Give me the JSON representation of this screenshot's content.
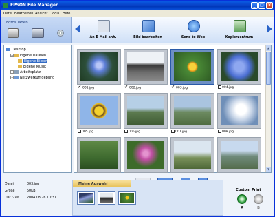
{
  "window": {
    "title": "EPSON File Manager"
  },
  "menu": [
    "Datei",
    "Bearbeiten",
    "Ansicht",
    "Tools",
    "Hilfe"
  ],
  "import_panel": {
    "label": "Fotos laden"
  },
  "toolbar": {
    "tools": [
      {
        "label": "An E-Mail anh.",
        "icon": "email-attach-icon",
        "color": "#7b8aa0"
      },
      {
        "label": "Bild bearbeiten",
        "icon": "edit-image-icon",
        "color": "#3f7bcf"
      },
      {
        "label": "Send to Web",
        "icon": "globe-icon",
        "color": "#2f6fd0"
      },
      {
        "label": "Kopierzentrum",
        "icon": "copy-center-icon",
        "color": "#5ea15a"
      }
    ]
  },
  "tree": [
    {
      "label": "Desktop",
      "level": 0,
      "expander": "",
      "icon_color": "#4f86d6"
    },
    {
      "label": "Eigene Dateien",
      "level": 1,
      "expander": "−",
      "icon_color": "#e3b84a"
    },
    {
      "label": "Eigene Bilder",
      "level": 2,
      "expander": "",
      "icon_color": "#e3b84a",
      "selected": true
    },
    {
      "label": "Eigene Musik",
      "level": 2,
      "expander": "",
      "icon_color": "#e3b84a"
    },
    {
      "label": "Arbeitsplatz",
      "level": 1,
      "expander": "+",
      "icon_color": "#8aa0b8"
    },
    {
      "label": "Netzwerkumgebung",
      "level": 1,
      "expander": "+",
      "icon_color": "#6f9ad6"
    }
  ],
  "thumbnails": [
    {
      "file": "001.jpg",
      "checked": true,
      "selected": false
    },
    {
      "file": "002.jpg",
      "checked": true,
      "selected": false
    },
    {
      "file": "003.jpg",
      "checked": true,
      "selected": true
    },
    {
      "file": "004.jpg",
      "checked": false,
      "selected": false
    },
    {
      "file": "005.jpg",
      "checked": false,
      "selected": false
    },
    {
      "file": "006.jpg",
      "checked": false,
      "selected": false
    },
    {
      "file": "007.jpg",
      "checked": false,
      "selected": false
    },
    {
      "file": "008.jpg",
      "checked": false,
      "selected": false
    },
    {
      "file": "",
      "checked": false,
      "selected": false
    },
    {
      "file": "",
      "checked": false,
      "selected": false
    },
    {
      "file": "",
      "checked": false,
      "selected": false
    },
    {
      "file": "",
      "checked": false,
      "selected": false
    }
  ],
  "info": {
    "name_key": "Datei",
    "name_val": "003.jpg",
    "size_key": "Größe",
    "size_val": "50KB",
    "date_key": "Dat./Zeit",
    "date_val": "2004.08.26 10:37"
  },
  "selection": {
    "tab": "Meine Auswahl",
    "items": [
      "001.jpg",
      "002.jpg",
      "003.jpg"
    ]
  },
  "custom_print": {
    "label": "Custom Print",
    "a": "A",
    "b": "B"
  }
}
